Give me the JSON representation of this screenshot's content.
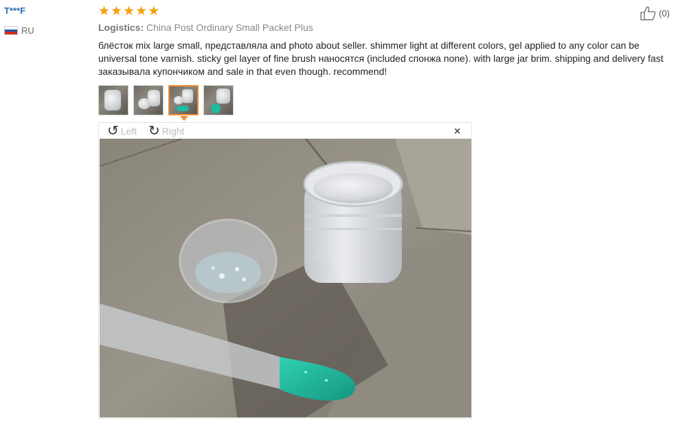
{
  "user": {
    "name": "T***F",
    "country": "RU"
  },
  "rating": {
    "stars": 5,
    "star_glyph": "★"
  },
  "helpful": {
    "count": "(0)",
    "icon": "thumbs-up-icon"
  },
  "logistics": {
    "label": "Logistics:",
    "value": "China Post Ordinary Small Packet Plus"
  },
  "review": {
    "text": "блёсток mix large small, представляла and photo about seller. shimmer light at different colors, gel applied to any color can be universal tone varnish. sticky gel layer of fine brush наносятся (included спонжа none). with large jar brim. shipping and delivery fast заказывала купончиком and sale in that even though. recommend!"
  },
  "thumbnails": {
    "count": 4,
    "active_index": 2
  },
  "viewer": {
    "rotate_left": "Left",
    "rotate_right": "Right",
    "close": "×",
    "rotate_left_glyph": "↺",
    "rotate_right_glyph": "↻"
  },
  "colors": {
    "accent": "#f08c2e",
    "star": "#f59e0b",
    "username": "#2b6cb0",
    "nail": "#1fb8a0"
  }
}
